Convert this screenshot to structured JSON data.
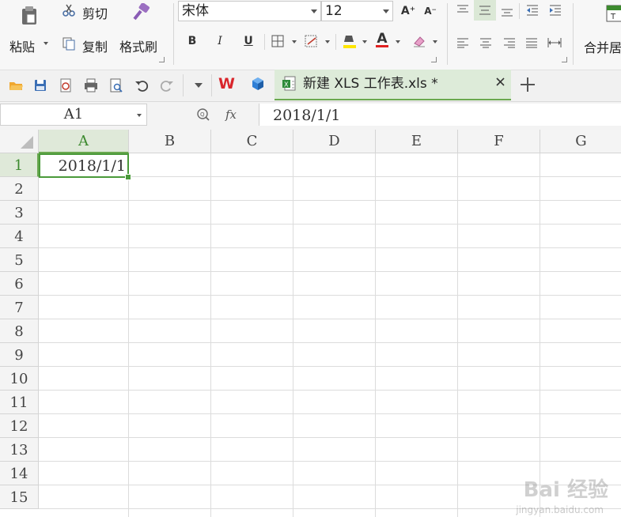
{
  "ribbon": {
    "paste": "粘贴",
    "cut": "剪切",
    "copy": "复制",
    "format_painter": "格式刷",
    "font_name": "宋体",
    "font_size": "12",
    "bold": "B",
    "italic": "I",
    "underline": "U",
    "font_color_glyph": "A",
    "merge": "合并居"
  },
  "tabs": {
    "wps_label": "W",
    "doc_title": "新建 XLS 工作表.xls *"
  },
  "formula_bar": {
    "name_box": "A1",
    "fx": "fx",
    "content": "2018/1/1"
  },
  "sheet": {
    "columns": [
      "A",
      "B",
      "C",
      "D",
      "E",
      "F",
      "G"
    ],
    "rows": [
      "1",
      "2",
      "3",
      "4",
      "5",
      "6",
      "7",
      "8",
      "9",
      "10",
      "11",
      "12",
      "13",
      "14",
      "15"
    ],
    "a1_value": "2018/1/1",
    "selected_color": "#4a9a3a"
  },
  "watermark": {
    "main": "Bai 经验",
    "sub": "jingyan.baidu.com"
  }
}
